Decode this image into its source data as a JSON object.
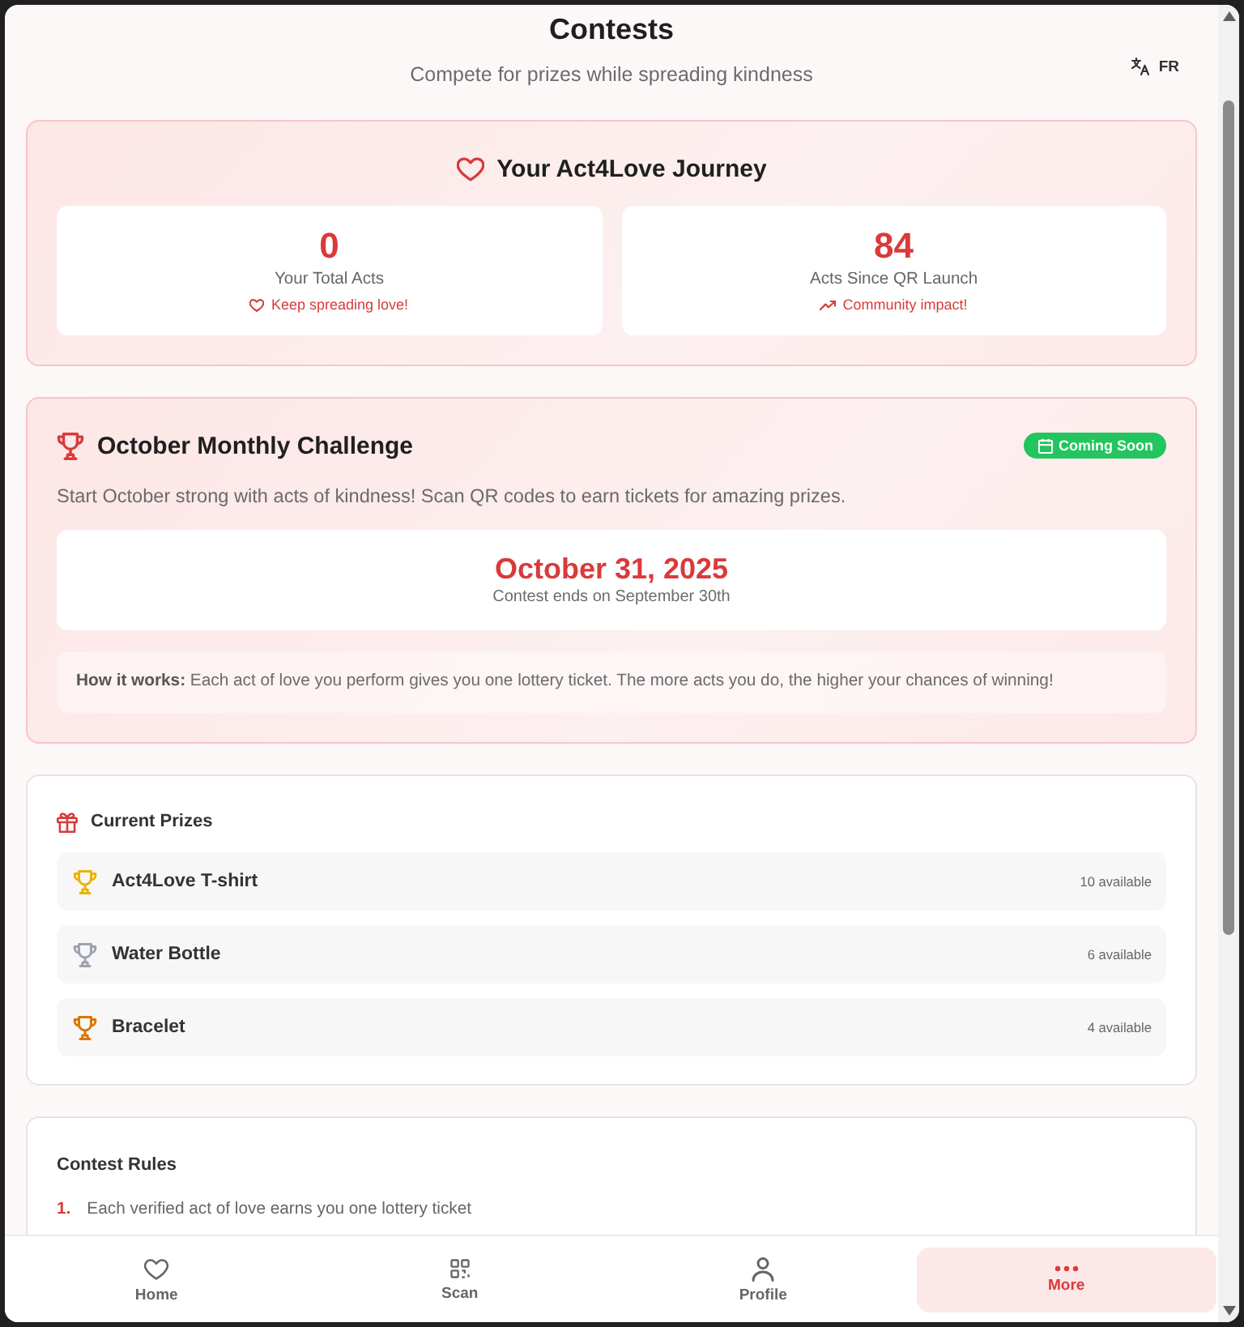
{
  "header": {
    "title": "Contests",
    "subtitle": "Compete for prizes while spreading kindness",
    "language_toggle": "FR"
  },
  "journey": {
    "title": "Your Act4Love Journey",
    "stats": [
      {
        "value": "0",
        "label": "Your Total Acts",
        "note": "Keep spreading love!"
      },
      {
        "value": "84",
        "label": "Acts Since QR Launch",
        "note": "Community impact!"
      }
    ]
  },
  "challenge": {
    "title": "October Monthly Challenge",
    "badge": "Coming Soon",
    "description": "Start October strong with acts of kindness! Scan QR codes to earn tickets for amazing prizes.",
    "date": "October 31, 2025",
    "date_note": "Contest ends on September 30th",
    "how_it_works": "**How it works:** Each act of love you perform gives you one lottery ticket. The more acts you do, the higher your chances of winning!"
  },
  "prizes": {
    "title": "Current Prizes",
    "items": [
      {
        "name": "Act4Love T-shirt",
        "availability": "10 available",
        "color": "#eab308"
      },
      {
        "name": "Water Bottle",
        "availability": "6 available",
        "color": "#9ca3af"
      },
      {
        "name": "Bracelet",
        "availability": "4 available",
        "color": "#d97706"
      }
    ]
  },
  "rules": {
    "title": "Contest Rules",
    "items": [
      {
        "number": "1.",
        "text": "Each verified act of love earns you one lottery ticket"
      }
    ]
  },
  "nav": [
    {
      "label": "Home",
      "selected": false
    },
    {
      "label": "Scan",
      "selected": false
    },
    {
      "label": "Profile",
      "selected": false
    },
    {
      "label": "More",
      "selected": true
    }
  ]
}
